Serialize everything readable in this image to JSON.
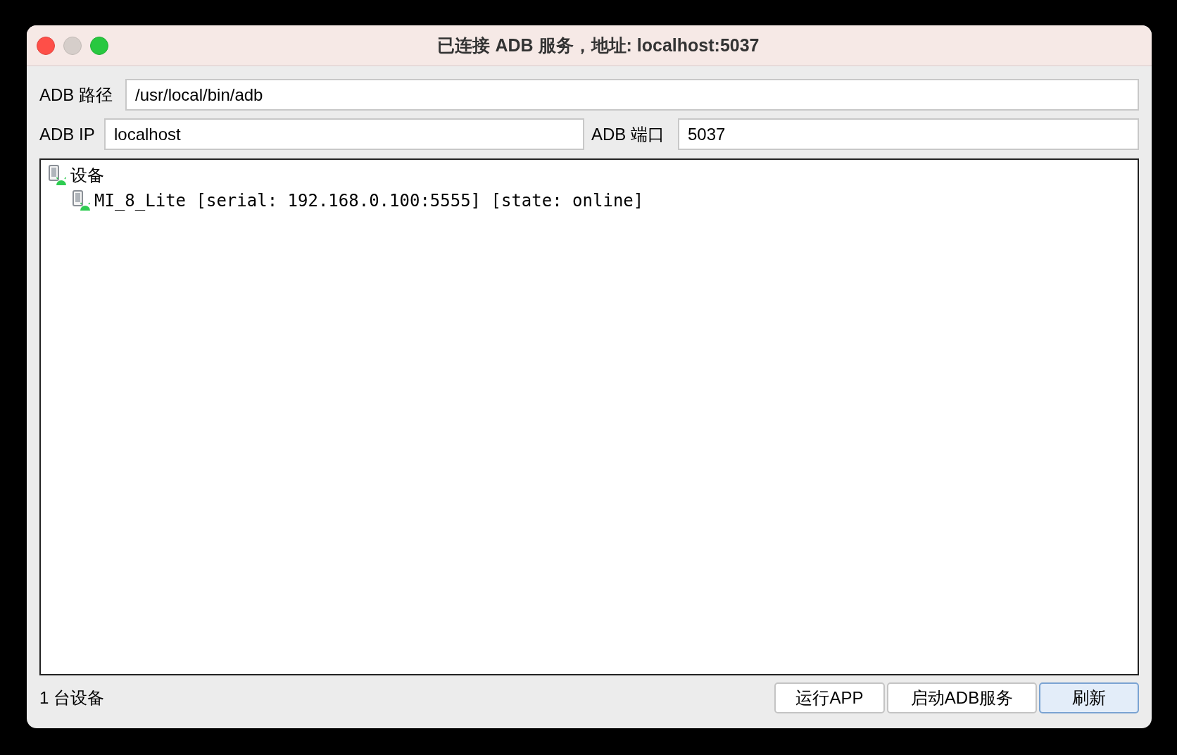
{
  "window": {
    "title": "已连接 ADB 服务，地址: localhost:5037"
  },
  "adb_path": {
    "label": "ADB 路径",
    "value": "/usr/local/bin/adb"
  },
  "adb_ip": {
    "label": "ADB IP",
    "value": "localhost"
  },
  "adb_port": {
    "label": "ADB 端口",
    "value": "5037"
  },
  "tree": [
    {
      "label": "设备",
      "children": [
        {
          "label": "MI_8_Lite [serial: 192.168.0.100:5555] [state: online]"
        }
      ]
    }
  ],
  "status": "1 台设备",
  "buttons": [
    {
      "label": "运行APP",
      "default": false
    },
    {
      "label": "启动ADB服务",
      "default": false
    },
    {
      "label": "刷新",
      "default": true
    }
  ]
}
